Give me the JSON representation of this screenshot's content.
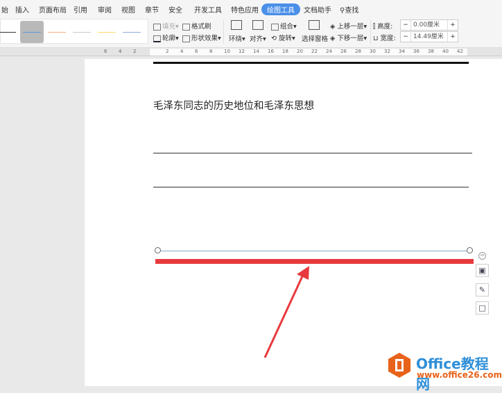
{
  "tabs": [
    "始",
    "插入",
    "页面布局",
    "引用",
    "审阅",
    "视图",
    "章节",
    "安全",
    "开发工具",
    "特色应用",
    "绘图工具",
    "文档助手",
    "查找"
  ],
  "active_tab": "绘图工具",
  "ribbon": {
    "fill": "填充",
    "format_painter": "格式刷",
    "outline": "轮廓",
    "shape_effects": "形状效果",
    "wrap": "环绕",
    "align": "对齐",
    "group": "组合",
    "rotate": "旋转",
    "selection_pane": "选择窗格",
    "bring_forward": "上移一层",
    "send_backward": "下移一层",
    "height_label": "高度:",
    "height_value": "0.00厘米",
    "width_label": "宽度:",
    "width_value": "14.49厘米",
    "minus": "−",
    "plus": "+"
  },
  "line_styles": [
    "#333333",
    "#5b9bd5",
    "#f4b183",
    "#c9c9c9",
    "#ffd966",
    "#8faadc"
  ],
  "ruler_ticks": [
    "6",
    "4",
    "2",
    "2",
    "4",
    "6",
    "8",
    "10",
    "12",
    "14",
    "16",
    "18",
    "20",
    "22",
    "24",
    "26",
    "28",
    "30",
    "32",
    "34",
    "36",
    "38",
    "40",
    "42"
  ],
  "document": {
    "title": "毛泽东同志的历史地位和毛泽东思想"
  },
  "colors": {
    "accent": "#4a8fe8",
    "red": "#e8393e"
  },
  "watermark": {
    "brand": "Office教程网",
    "url": "www.office26.com"
  }
}
